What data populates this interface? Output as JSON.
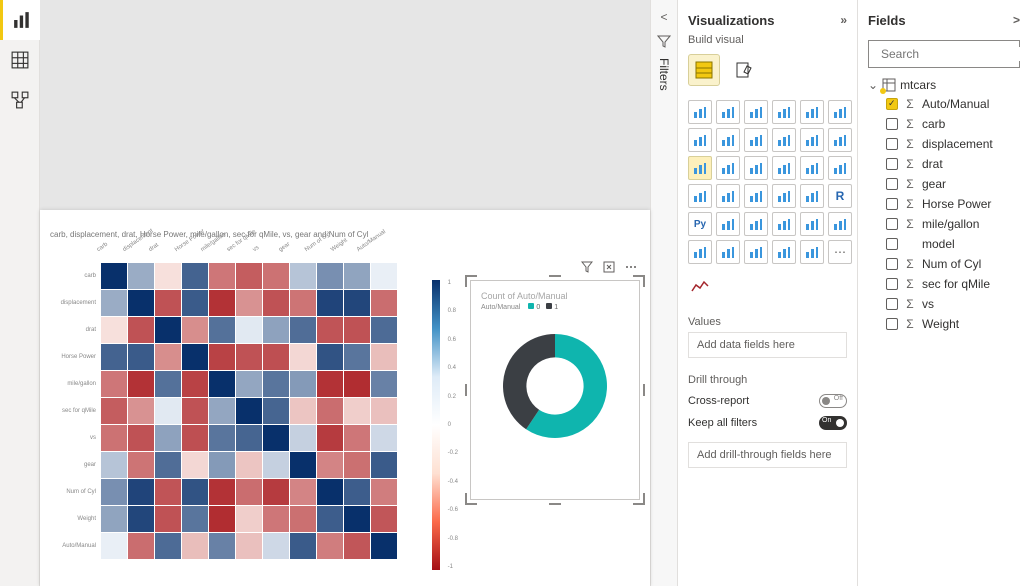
{
  "filters_label": "Filters",
  "viz": {
    "title": "Visualizations",
    "subtitle": "Build visual",
    "values_label": "Values",
    "values_placeholder": "Add data fields here",
    "drill_label": "Drill through",
    "cross_label": "Cross-report",
    "cross_state": "Off",
    "keep_label": "Keep all filters",
    "keep_state": "On",
    "drill_placeholder": "Add drill-through fields here"
  },
  "fields": {
    "title": "Fields",
    "search_placeholder": "Search",
    "table": "mtcars",
    "items": [
      {
        "label": "Auto/Manual",
        "sigma": true,
        "checked": true
      },
      {
        "label": "carb",
        "sigma": true,
        "checked": false
      },
      {
        "label": "displacement",
        "sigma": true,
        "checked": false
      },
      {
        "label": "drat",
        "sigma": true,
        "checked": false
      },
      {
        "label": "gear",
        "sigma": true,
        "checked": false
      },
      {
        "label": "Horse Power",
        "sigma": true,
        "checked": false
      },
      {
        "label": "mile/gallon",
        "sigma": true,
        "checked": false
      },
      {
        "label": "model",
        "sigma": false,
        "checked": false
      },
      {
        "label": "Num of Cyl",
        "sigma": true,
        "checked": false
      },
      {
        "label": "sec for qMile",
        "sigma": true,
        "checked": false
      },
      {
        "label": "vs",
        "sigma": true,
        "checked": false
      },
      {
        "label": "Weight",
        "sigma": true,
        "checked": false
      }
    ]
  },
  "heatmap": {
    "title": "carb, displacement, drat, Horse Power, mile/gallon, sec for qMile, vs, gear and Num of Cyl",
    "labels": [
      "carb",
      "displacement",
      "drat",
      "Horse Power",
      "mile/gallon",
      "sec for qMile",
      "vs",
      "gear",
      "Num of Cyl",
      "Weight",
      "Auto/Manual"
    ],
    "ticks": [
      "1",
      "0.8",
      "0.6",
      "0.4",
      "0.2",
      "0",
      "-0.2",
      "-0.4",
      "-0.6",
      "-0.8",
      "-1"
    ]
  },
  "donut": {
    "title": "Count of Auto/Manual",
    "legend_field": "Auto/Manual",
    "legend": [
      {
        "label": "0",
        "color": "#0fb5ae"
      },
      {
        "label": "1",
        "color": "#3b3f44"
      }
    ]
  },
  "chart_data": [
    {
      "type": "heatmap",
      "title": "carb, displacement, drat, Horse Power, mile/gallon, sec for qMile, vs, gear and Num of Cyl",
      "x_labels": [
        "carb",
        "displacement",
        "drat",
        "Horse Power",
        "mile/gallon",
        "sec for qMile",
        "vs",
        "gear",
        "Num of Cyl",
        "Weight",
        "Auto/Manual"
      ],
      "y_labels": [
        "carb",
        "displacement",
        "drat",
        "Horse Power",
        "mile/gallon",
        "sec for qMile",
        "vs",
        "gear",
        "Num of Cyl",
        "Weight",
        "Auto/Manual"
      ],
      "zlim": [
        -1,
        1
      ],
      "values": [
        [
          1.0,
          0.39,
          -0.09,
          0.75,
          -0.55,
          -0.66,
          -0.57,
          0.27,
          0.53,
          0.43,
          0.06
        ],
        [
          0.39,
          1.0,
          -0.71,
          0.79,
          -0.85,
          -0.43,
          -0.71,
          -0.56,
          0.9,
          0.89,
          -0.59
        ],
        [
          -0.09,
          -0.71,
          1.0,
          -0.45,
          0.68,
          0.09,
          0.44,
          0.7,
          -0.7,
          -0.71,
          0.71
        ],
        [
          0.75,
          0.79,
          -0.45,
          1.0,
          -0.78,
          -0.71,
          -0.72,
          -0.13,
          0.83,
          0.66,
          -0.24
        ],
        [
          -0.55,
          -0.85,
          0.68,
          -0.78,
          1.0,
          0.42,
          0.66,
          0.48,
          -0.85,
          -0.87,
          0.6
        ],
        [
          -0.66,
          -0.43,
          0.09,
          -0.71,
          0.42,
          1.0,
          0.74,
          -0.21,
          -0.59,
          -0.17,
          -0.23
        ],
        [
          -0.57,
          -0.71,
          0.44,
          -0.72,
          0.66,
          0.74,
          1.0,
          0.21,
          -0.81,
          -0.55,
          0.17
        ],
        [
          0.27,
          -0.56,
          0.7,
          -0.13,
          0.48,
          -0.21,
          0.21,
          1.0,
          -0.49,
          -0.58,
          0.79
        ],
        [
          0.53,
          0.9,
          -0.7,
          0.83,
          -0.85,
          -0.59,
          -0.81,
          -0.49,
          1.0,
          0.78,
          -0.52
        ],
        [
          0.43,
          0.89,
          -0.71,
          0.66,
          -0.87,
          -0.17,
          -0.55,
          -0.58,
          0.78,
          1.0,
          -0.69
        ],
        [
          0.06,
          -0.59,
          0.71,
          -0.24,
          0.6,
          -0.23,
          0.17,
          0.79,
          -0.52,
          -0.69,
          1.0
        ]
      ]
    },
    {
      "type": "pie",
      "title": "Count of Auto/Manual",
      "series": [
        {
          "name": "0",
          "value": 19,
          "color": "#0fb5ae"
        },
        {
          "name": "1",
          "value": 13,
          "color": "#3b3f44"
        }
      ]
    }
  ]
}
